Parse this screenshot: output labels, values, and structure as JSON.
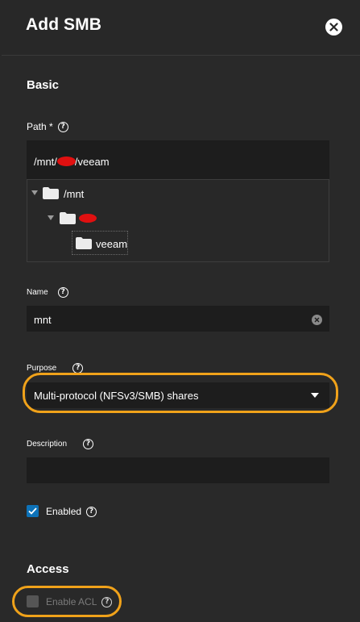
{
  "header": {
    "title": "Add SMB"
  },
  "basic": {
    "section_title": "Basic",
    "path": {
      "label": "Path *",
      "value": "/mnt/",
      "value_tail": "/veeam",
      "tree": [
        {
          "label": "/mnt",
          "expanded": true
        },
        {
          "label": "",
          "expanded": true,
          "redacted": true
        },
        {
          "label": "veeam",
          "expanded": false,
          "selected": true
        }
      ]
    },
    "name": {
      "label": "Name",
      "value": "mnt"
    },
    "purpose": {
      "label": "Purpose",
      "value": "Multi-protocol (NFSv3/SMB) shares"
    },
    "description": {
      "label": "Description",
      "value": ""
    },
    "enabled": {
      "label": "Enabled",
      "checked": true
    }
  },
  "access": {
    "section_title": "Access",
    "enable_acl": {
      "label": "Enable ACL",
      "checked": false,
      "disabled": true
    }
  },
  "colors": {
    "background": "#282828",
    "input_background": "#1d1d1d",
    "accent_checkbox": "#0d72b8",
    "annotation": "#f0a21a",
    "redaction": "#e01010"
  }
}
